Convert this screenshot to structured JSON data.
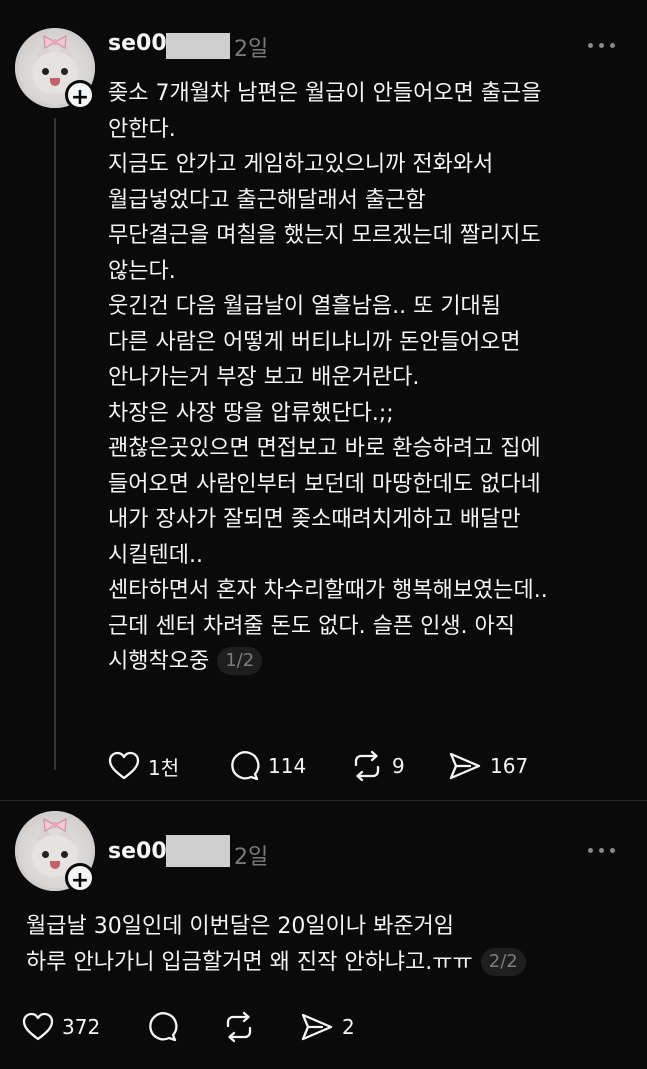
{
  "post1": {
    "username": "se00",
    "time": "2일",
    "lines": [
      "좆소 7개월차 남편은 월급이 안들어오면 출근을",
      "안한다.",
      "지금도 안가고 게임하고있으니까 전화와서",
      "월급넣었다고 출근해달래서 출근함",
      "무단결근을 며칠을 했는지 모르겠는데 짤리지도",
      "않는다.",
      "웃긴건 다음 월급날이 열흘남음.. 또 기대됨",
      "다른 사람은 어떻게 버티냐니까 돈안들어오면",
      "안나가는거 부장 보고 배운거란다.",
      "차장은 사장 땅을 압류했단다.;;",
      "괜찮은곳있으면 면접보고 바로 환승하려고 집에",
      "들어오면 사람인부터 보던데 마땅한데도 없다네",
      "내가 장사가 잘되면 좆소때려치게하고 배달만",
      "시킬텐데..",
      "센타하면서 혼자 차수리할때가 행복해보였는데..",
      "근데 센터 차려줄 돈도 없다. 슬픈 인생. 아직"
    ],
    "last_line": "시행착오중",
    "page": "1/2",
    "likes": "1천",
    "comments": "114",
    "reposts": "9",
    "shares": "167"
  },
  "post2": {
    "username": "se00",
    "time": "2일",
    "lines": [
      "월급날 30일인데 이번달은 20일이나 봐준거임"
    ],
    "last_line": "하루 안나가니 입금할거면 왜 진작 안하냐고.ㅠㅠ",
    "page": "2/2",
    "likes": "372",
    "comments": "",
    "reposts": "",
    "shares": "2"
  },
  "icons": {
    "follow": "plus-icon",
    "more": "more-dots-icon",
    "like": "heart-icon",
    "comment": "comment-icon",
    "repost": "repost-icon",
    "share": "share-icon"
  },
  "colors": {
    "background": "#0a0a0a",
    "text": "#f3f5f7",
    "muted": "#7a7a7a",
    "thread_line": "#333638"
  }
}
